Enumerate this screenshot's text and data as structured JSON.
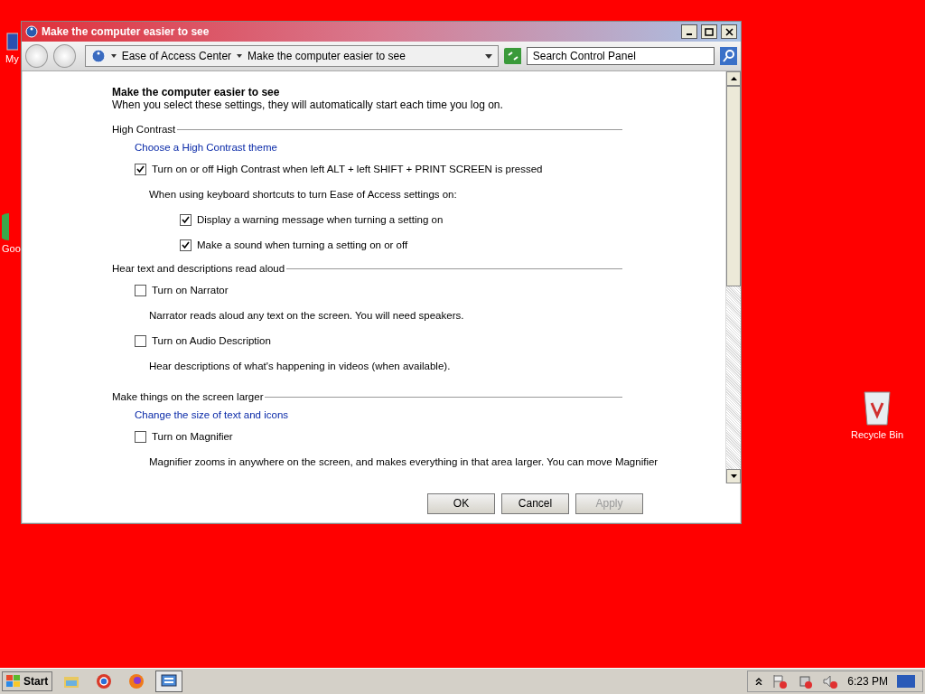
{
  "desktop_icons": [
    {
      "label": "My",
      "kind": "computer"
    },
    {
      "label": "Goo",
      "kind": "chrome"
    },
    {
      "label": "Recycle Bin",
      "kind": "bin"
    }
  ],
  "window": {
    "title": "Make the computer easier to see",
    "breadcrumb": [
      "Ease of Access Center",
      "Make the computer easier to see"
    ],
    "search": {
      "placeholder": "Search Control Panel"
    }
  },
  "page": {
    "heading": "Make the computer easier to see",
    "subtitle": "When you select these settings, they will automatically start each time you log on.",
    "sections": [
      {
        "title": "High Contrast",
        "items": [
          {
            "kind": "link",
            "text": "Choose a High Contrast theme"
          },
          {
            "kind": "checkbox",
            "label": "Turn on or off High Contrast when left ALT + left SHIFT + PRINT SCREEN is pressed",
            "checked": true
          },
          {
            "kind": "group",
            "text": "When using keyboard shortcuts to turn Ease of Access settings on:",
            "children": [
              {
                "kind": "checkbox",
                "label": "Display a warning message when turning a setting on",
                "checked": true
              },
              {
                "kind": "checkbox",
                "label": "Make a sound when turning a setting on or off",
                "checked": true
              }
            ]
          }
        ]
      },
      {
        "title": "Hear text and descriptions read aloud",
        "items": [
          {
            "kind": "checkbox",
            "label": "Turn on Narrator",
            "checked": false
          },
          {
            "kind": "note",
            "text": "Narrator reads aloud any text on the screen. You will need speakers."
          },
          {
            "kind": "checkbox",
            "label": "Turn on Audio Description",
            "checked": false
          },
          {
            "kind": "note",
            "text": "Hear descriptions of what's happening in videos (when available)."
          }
        ]
      },
      {
        "title": "Make things on the screen larger",
        "items": [
          {
            "kind": "link",
            "text": "Change the size of text and icons"
          },
          {
            "kind": "checkbox",
            "label": "Turn on Magnifier",
            "checked": false
          },
          {
            "kind": "note",
            "text": "Magnifier zooms in anywhere on the screen, and makes everything in that area larger. You can move Magnifier"
          }
        ]
      }
    ]
  },
  "buttons": [
    {
      "label": "OK",
      "disabled": false
    },
    {
      "label": "Cancel",
      "disabled": false
    },
    {
      "label": "Apply",
      "disabled": true
    }
  ],
  "taskbar": {
    "start": "Start",
    "apps": [
      {
        "kind": "folder",
        "selected": false
      },
      {
        "kind": "chrome",
        "selected": false
      },
      {
        "kind": "firefox",
        "selected": false
      },
      {
        "kind": "control-panel",
        "selected": true
      }
    ],
    "clock": "6:23 PM"
  }
}
